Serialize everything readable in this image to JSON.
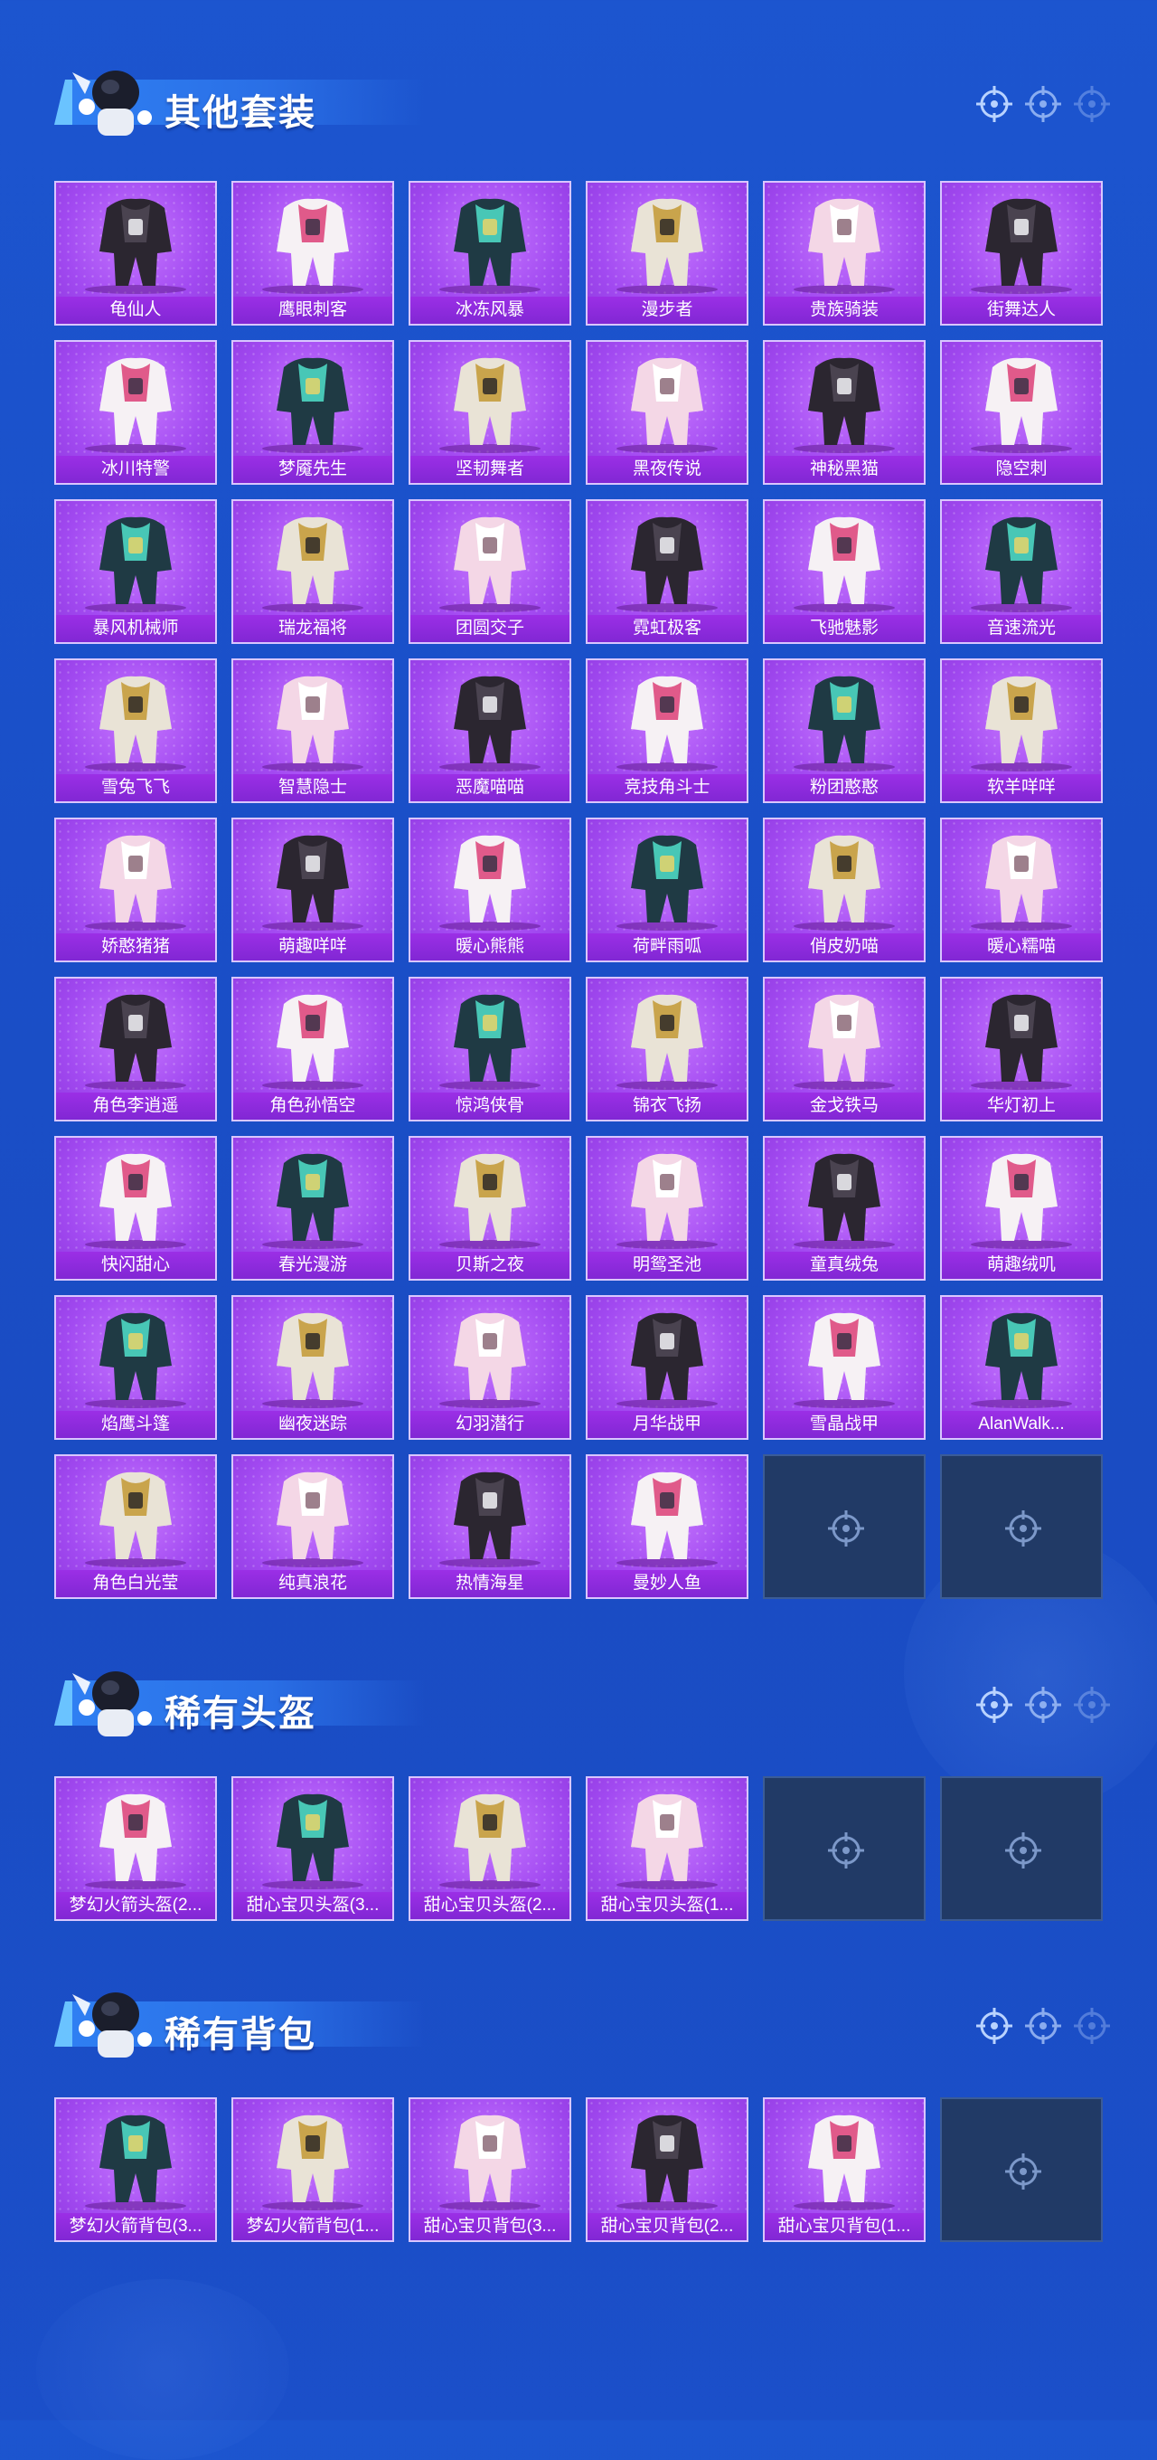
{
  "sections": [
    {
      "title": "其他套装",
      "items": [
        "龟仙人",
        "鹰眼刺客",
        "冰冻风暴",
        "漫步者",
        "贵族骑装",
        "街舞达人",
        "冰川特警",
        "梦魇先生",
        "坚韧舞者",
        "黑夜传说",
        "神秘黑猫",
        "隐空刺",
        "暴风机械师",
        "瑞龙福将",
        "团圆交子",
        "霓虹极客",
        "飞驰魅影",
        "音速流光",
        "雪兔飞飞",
        "智慧隐士",
        "恶魔喵喵",
        "竞技角斗士",
        "粉团憨憨",
        "软羊咩咩",
        "娇憨猪猪",
        "萌趣咩咩",
        "暖心熊熊",
        "荷畔雨呱",
        "俏皮奶喵",
        "暖心糯喵",
        "角色李逍遥",
        "角色孙悟空",
        "惊鸿侠骨",
        "锦衣飞扬",
        "金戈铁马",
        "华灯初上",
        "快闪甜心",
        "春光漫游",
        "贝斯之夜",
        "明鸳圣池",
        "童真绒兔",
        "萌趣绒叽",
        "焰鹰斗篷",
        "幽夜迷踪",
        "幻羽潜行",
        "月华战甲",
        "雪晶战甲",
        "AlanWalk...",
        "角色白光莹",
        "纯真浪花",
        "热情海星",
        "曼妙人鱼"
      ],
      "empty_slots": 2
    },
    {
      "title": "稀有头盔",
      "items": [
        "梦幻火箭头盔(2...",
        "甜心宝贝头盔(3...",
        "甜心宝贝头盔(2...",
        "甜心宝贝头盔(1..."
      ],
      "empty_slots": 2
    },
    {
      "title": "稀有背包",
      "items": [
        "梦幻火箭背包(3...",
        "梦幻火箭背包(1...",
        "甜心宝贝背包(3...",
        "甜心宝贝背包(2...",
        "甜心宝贝背包(1..."
      ],
      "empty_slots": 1
    }
  ],
  "icons": {
    "section_deco": "crosshair-icon",
    "mascot": "mascot-icon",
    "empty_slot": "crosshair-icon"
  },
  "colors": {
    "background": "#1b50c9",
    "card_purple": "#a24af1",
    "label_bar": "#8a2bd9",
    "empty_slot": "#213a66"
  }
}
